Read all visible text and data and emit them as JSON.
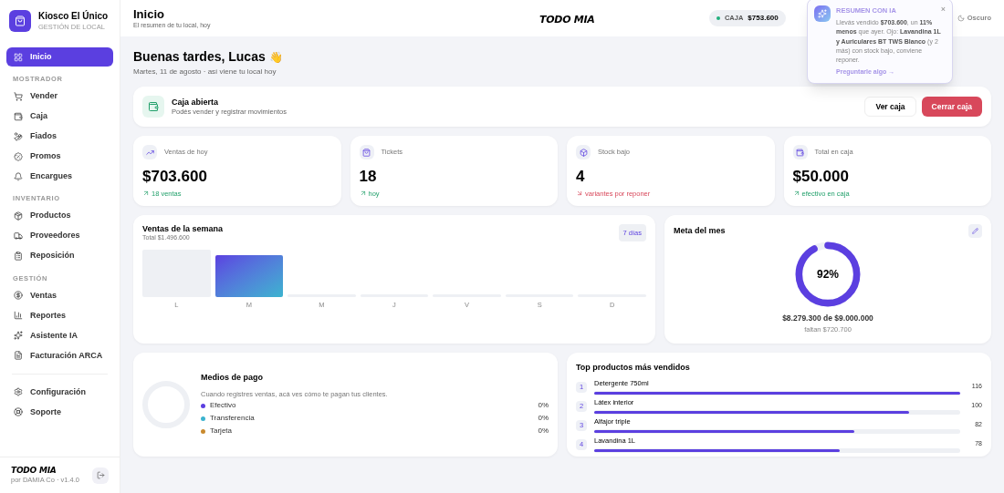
{
  "brand": {
    "name": "Kiosco El Único",
    "subtitle": "GESTIÓN DE LOCAL"
  },
  "sidebar": {
    "sections": [
      {
        "items": [
          {
            "label": "Inicio",
            "selected": true
          }
        ]
      },
      {
        "title": "MOSTRADOR",
        "items": [
          {
            "label": "Vender",
            "selected": false
          },
          {
            "label": "Caja",
            "selected": false
          },
          {
            "label": "Fiados",
            "selected": false
          },
          {
            "label": "Promos",
            "selected": false
          },
          {
            "label": "Encargues",
            "selected": false
          }
        ]
      },
      {
        "title": "INVENTARIO",
        "items": [
          {
            "label": "Productos",
            "selected": false
          },
          {
            "label": "Proveedores",
            "selected": false
          },
          {
            "label": "Reposición",
            "selected": false
          }
        ]
      },
      {
        "title": "GESTIÓN",
        "items": [
          {
            "label": "Ventas",
            "selected": false
          },
          {
            "label": "Reportes",
            "selected": false
          },
          {
            "label": "Asistente IA",
            "selected": false
          },
          {
            "label": "Facturación ARCA",
            "selected": false
          }
        ]
      }
    ],
    "bottom_items": [
      {
        "label": "Configuración",
        "selected": false
      },
      {
        "label": "Soporte",
        "selected": false
      }
    ],
    "footer": {
      "logo": "TODO MIA",
      "version": "por DAMIA Co · v1.4.0"
    }
  },
  "header": {
    "title": "Inicio",
    "subtitle": "El resumen de tu local, hoy",
    "logo": "TODO MIA",
    "caja_label": "CAJA",
    "caja_amount": "$753.600",
    "theme_toggle": "Oscuro"
  },
  "ai_popup": {
    "title": "RESUMEN CON IA",
    "text": "Llevás vendido **$703.600**, un **11% menos** que ayer. Ojo: **Lavandina 1L y Auriculares BT TWS Blanco** (y 2 más) con stock bajo, conviene reponer.",
    "link": "Preguntarle algo →",
    "close": "×"
  },
  "greeting": {
    "title": "Buenas tardes, Lucas",
    "emoji": "👋",
    "subtitle": "Martes, 11 de agosto · así viene tu local hoy"
  },
  "caja": {
    "title": "Caja abierta",
    "subtitle": "Podés vender y registrar movimientos",
    "buttons": [
      {
        "label": "Ver caja",
        "kind": "secondary"
      },
      {
        "label": "Cerrar caja",
        "kind": "danger"
      }
    ]
  },
  "stats": [
    {
      "label": "Ventas de hoy",
      "value": "$703.600",
      "note": "18 ventas",
      "kind": "up"
    },
    {
      "label": "Tickets",
      "value": "18",
      "note": "hoy",
      "kind": "up"
    },
    {
      "label": "Stock bajo",
      "value": "4",
      "note": "variantes por reponer",
      "kind": "down"
    },
    {
      "label": "Total en caja",
      "value": "$50.000",
      "note": "efectivo en caja",
      "kind": "up"
    }
  ],
  "week": {
    "title": "Ventas de la semana",
    "total": "Total $1.496.600",
    "range": "7 días",
    "days": [
      {
        "label": "L",
        "active": false
      },
      {
        "label": "M",
        "active": true
      },
      {
        "label": "M",
        "active": false
      },
      {
        "label": "J",
        "active": false
      },
      {
        "label": "V",
        "active": false
      },
      {
        "label": "S",
        "active": false
      },
      {
        "label": "D",
        "active": false
      }
    ]
  },
  "goal": {
    "title": "Meta del mes",
    "percent": "92%",
    "level": 0.92,
    "amount": "$8.279.300 de $9.000.000",
    "remaining": "faltan $720.700"
  },
  "payments": {
    "title": "Medios de pago",
    "hint": "Cuando registres ventas, acá ves cómo te pagan tus clientes.",
    "methods": [
      {
        "label": "Efectivo",
        "value": "0%",
        "color": "#5b3fe0"
      },
      {
        "label": "Transferencia",
        "value": "0%",
        "color": "#3bb3cf"
      },
      {
        "label": "Tarjeta",
        "value": "0%",
        "color": "#c98a2e"
      }
    ]
  },
  "top_products": {
    "title": "Top productos más vendidos",
    "items": [
      {
        "rank": "1",
        "name": "Detergente 750ml",
        "count": "116",
        "level": 1
      },
      {
        "rank": "2",
        "name": "Látex interior",
        "count": "100",
        "level": 0.86
      },
      {
        "rank": "3",
        "name": "Alfajor triple",
        "count": "82",
        "level": 0.71
      },
      {
        "rank": "4",
        "name": "Lavandina 1L",
        "count": "78",
        "level": 0.67
      }
    ]
  }
}
